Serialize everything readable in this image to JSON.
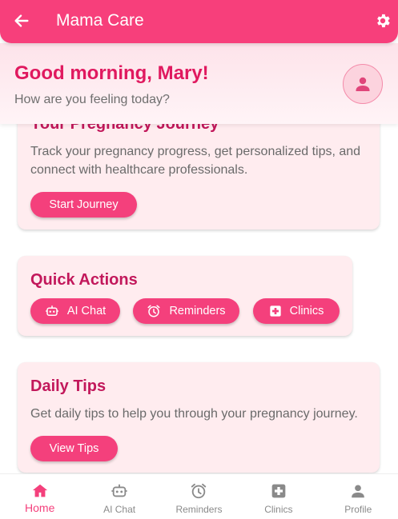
{
  "app_bar": {
    "title": "Mama Care",
    "back_icon": "arrow-back-icon",
    "settings_icon": "gear-icon"
  },
  "greeting": {
    "hello": "Good morning, Mary!",
    "sub": "How are you feeling today?",
    "avatar_icon": "person-icon"
  },
  "journey_card": {
    "title": "Your Pregnancy Journey",
    "text": "Track your pregnancy progress, get personalized tips, and connect with healthcare professionals.",
    "button": "Start Journey"
  },
  "quick_actions": {
    "title": "Quick Actions",
    "buttons": [
      {
        "label": "AI Chat",
        "icon": "robot-icon"
      },
      {
        "label": "Reminders",
        "icon": "alarm-icon"
      },
      {
        "label": "Clinics",
        "icon": "medical-cross-icon"
      }
    ]
  },
  "daily_tips": {
    "title": "Daily Tips",
    "text": "Get daily tips to help you through your pregnancy journey.",
    "button": "View Tips"
  },
  "bottom_nav": {
    "items": [
      {
        "label": "Home",
        "icon": "home-icon",
        "active": true
      },
      {
        "label": "AI Chat",
        "icon": "robot-icon",
        "active": false
      },
      {
        "label": "Reminders",
        "icon": "alarm-icon",
        "active": false
      },
      {
        "label": "Clinics",
        "icon": "medical-cross-icon",
        "active": false
      },
      {
        "label": "Profile",
        "icon": "person-icon",
        "active": false
      }
    ]
  },
  "colors": {
    "primary": "#f73f7b",
    "accent_text": "#c2185b",
    "card_bg": "#ffecef",
    "greeting_text": "#e0195f",
    "inactive_nav": "#8a8a8a"
  }
}
